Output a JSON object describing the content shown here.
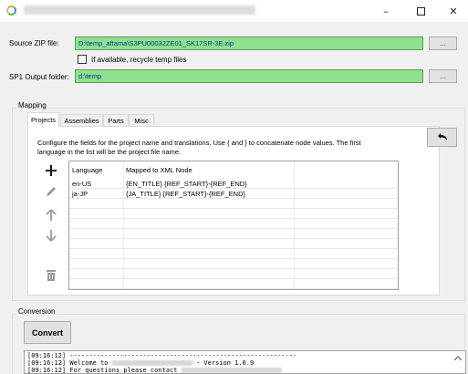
{
  "window": {
    "app_icon": "app-logo-icon",
    "controls": {
      "minimize": "–",
      "close": "✕"
    }
  },
  "source": {
    "label": "Source ZIP file:",
    "value": "D:\\temp_aftama\\S3PU00032ZE01_SK17SR-3E.zip",
    "browse": "...",
    "recycle_label": "If available, recycle temp files"
  },
  "output": {
    "label": "SP1 Output folder:",
    "value": "d:\\temp",
    "browse": "..."
  },
  "mapping": {
    "title": "Mapping",
    "tabs": [
      {
        "label": "Projects",
        "active": true
      },
      {
        "label": "Assemblies",
        "active": false
      },
      {
        "label": "Parts",
        "active": false
      },
      {
        "label": "Misc",
        "active": false
      }
    ],
    "description_line1": "Configure the fields for the project name and translations. Use { and } to concatenate node values. The first",
    "description_line2": "language in the list will be the project file name.",
    "columns": [
      "Language",
      "Mapped to XML Node"
    ],
    "rows": [
      {
        "language": "en-US",
        "node": "{EN_TITLE} {REF_START}-{REF_END}"
      },
      {
        "language": "ja-JP",
        "node": "{JA_TITLE} {REF_START}-{REF_END}"
      }
    ],
    "tools": [
      "add-icon",
      "edit-icon",
      "move-up-icon",
      "move-down-icon",
      "delete-icon"
    ]
  },
  "conversion": {
    "title": "Conversion",
    "convert_label": "Convert",
    "log": [
      {
        "time": "[09:16:12]",
        "text": " -----------------------------------------------------------"
      },
      {
        "time": "[09:16:12]",
        "text": " Welcome to ",
        "suffix": " - Version 1.0.9"
      },
      {
        "time": "[09:16:12]",
        "text": " For questions please contact "
      }
    ]
  }
}
